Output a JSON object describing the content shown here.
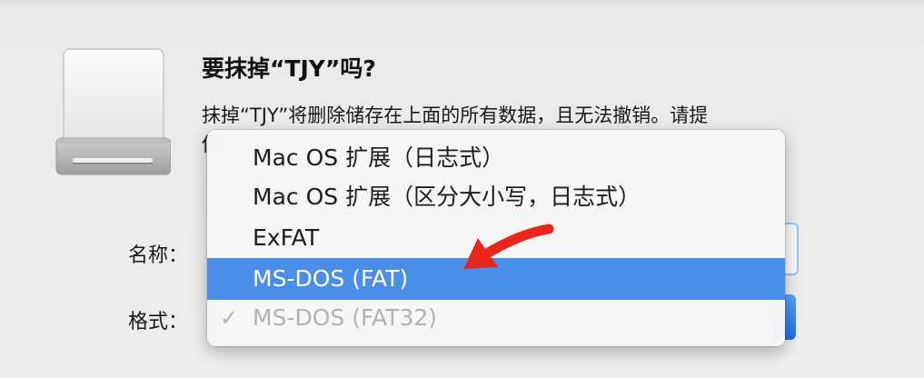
{
  "dialog": {
    "title": "要抹掉“TJY”吗?",
    "description_line1": "抹掉“TJY”将删除储存在上面的所有数据，且无法撤销。请提",
    "description_line2": "供"
  },
  "form": {
    "name_label": "名称：",
    "format_label": "格式："
  },
  "format_menu": {
    "items": [
      {
        "label": "Mac OS 扩展（日志式）",
        "state": "normal"
      },
      {
        "label": "Mac OS 扩展（区分大小写，日志式）",
        "state": "normal"
      },
      {
        "label": "ExFAT",
        "state": "normal"
      },
      {
        "label": "MS-DOS (FAT)",
        "state": "highlighted"
      },
      {
        "label": "MS-DOS (FAT32)",
        "state": "checked-disabled"
      }
    ],
    "checkmark": "✓"
  },
  "icons": {
    "drive": "external-drive-icon",
    "annotation": "red-arrow-annotation"
  },
  "colors": {
    "highlight": "#4b8ee8",
    "arrow": "#e8261c",
    "disabled_text": "#b2b2b2"
  }
}
